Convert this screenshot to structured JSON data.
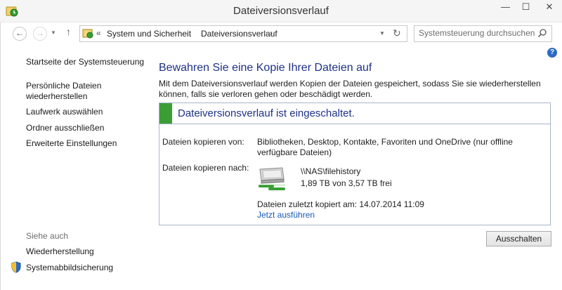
{
  "window": {
    "title": "Dateiversionsverlauf",
    "min": "—",
    "max": "☐",
    "close": "✕"
  },
  "navigation": {
    "back": "←",
    "forward": "→",
    "dropdown": "▼",
    "up": "↑",
    "breadcrumb_chevron": "«",
    "breadcrumb": [
      "System und Sicherheit",
      "Dateiversionsverlauf"
    ],
    "breadcrumb_sep": "›",
    "address_dropdown": "▼",
    "refresh": "↻"
  },
  "search": {
    "placeholder": "Systemsteuerung durchsuchen"
  },
  "help": "?",
  "left_pane": {
    "home": "Startseite der Systemsteuerung",
    "restore": "Persönliche Dateien wiederherstellen",
    "select_drive": "Laufwerk auswählen",
    "exclude_folders": "Ordner ausschließen",
    "advanced": "Erweiterte Einstellungen",
    "see_also": "Siehe auch",
    "recovery": "Wiederherstellung",
    "system_image": "Systemabbildsicherung"
  },
  "main": {
    "heading": "Bewahren Sie eine Kopie Ihrer Dateien auf",
    "description": "Mit dem Dateiversionsverlauf werden Kopien der Dateien gespeichert, sodass Sie sie wiederherstellen können, falls sie verloren gehen oder beschädigt werden.",
    "status": "Dateiversionsverlauf ist eingeschaltet.",
    "copy_from_label": "Dateien kopieren von:",
    "copy_from_value": "Bibliotheken, Desktop, Kontakte, Favoriten und OneDrive (nur offline verfügbare Dateien)",
    "copy_to_label": "Dateien kopieren nach:",
    "dest_path": "\\\\NAS\\filehistory",
    "dest_space": "1,89 TB von 3,57 TB frei",
    "last_copy": "Dateien zuletzt kopiert am: 14.07.2014 11:09",
    "run_now": "Jetzt ausführen",
    "turn_off_button": "Ausschalten"
  },
  "colors": {
    "heading": "#1e3287",
    "link": "#1559b6",
    "status_green": "#3a9e35",
    "box_border": "#a8b5c8"
  }
}
